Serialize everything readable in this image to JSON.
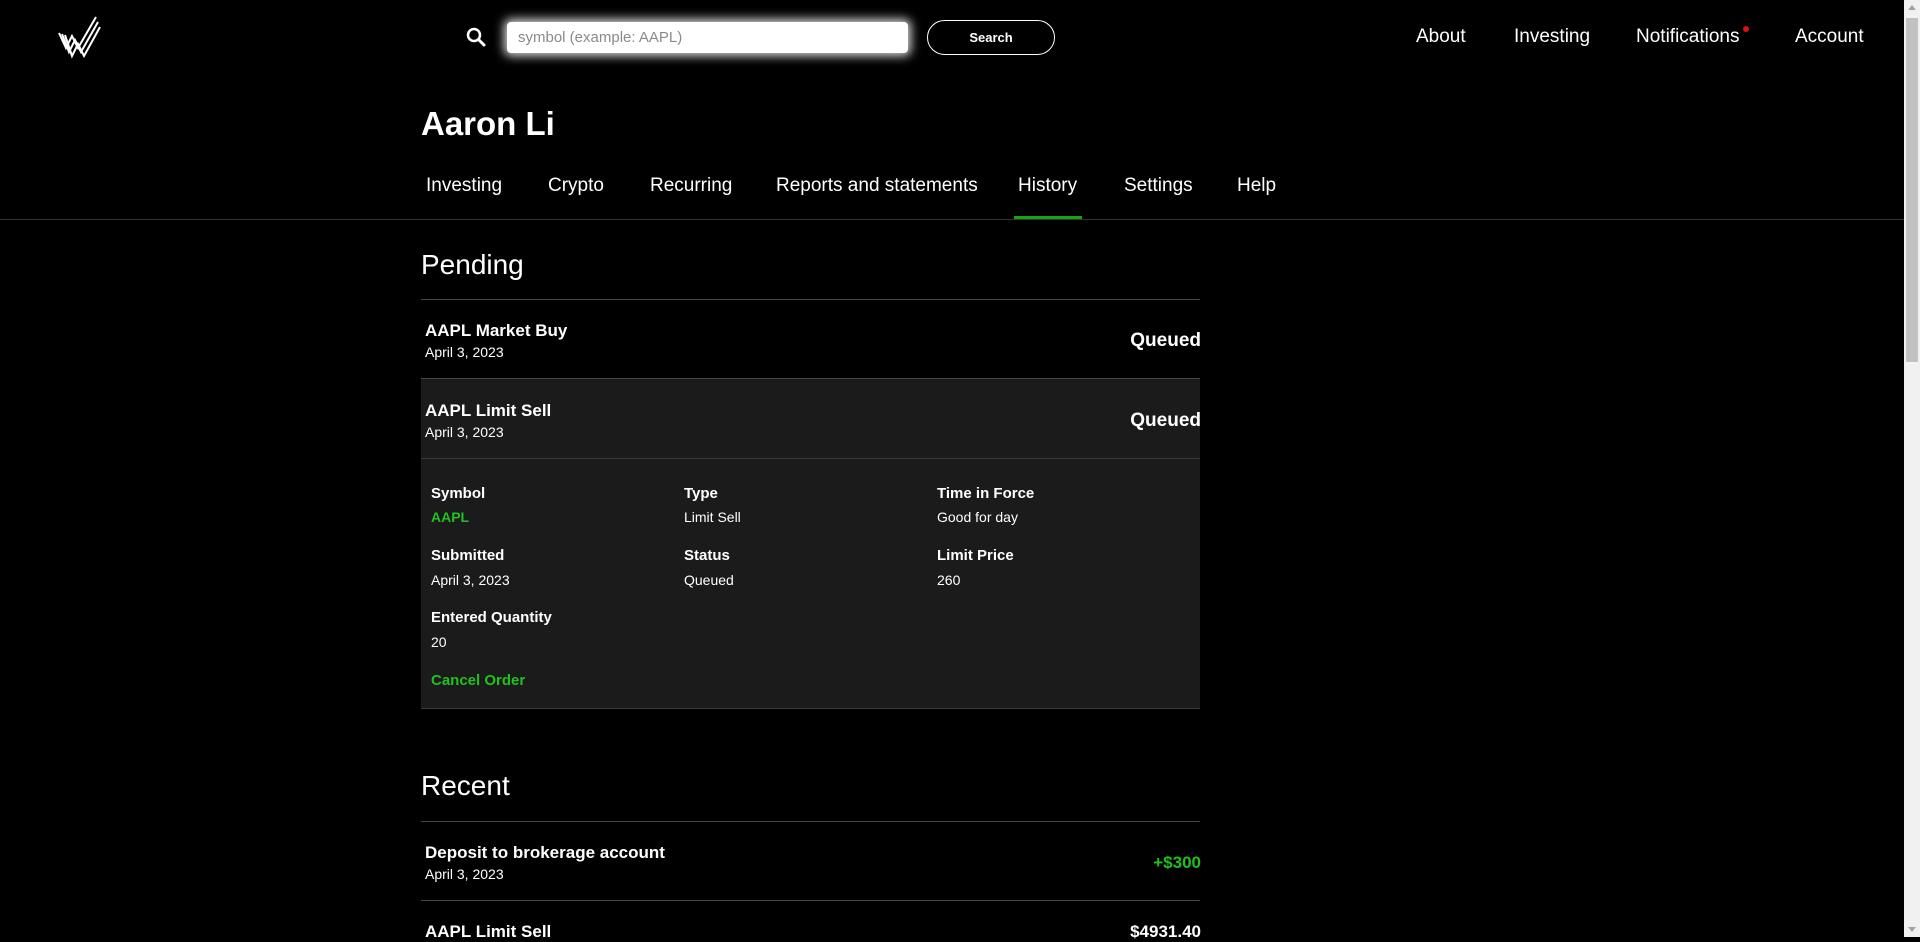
{
  "header": {
    "logo_icon": "w-logo-icon",
    "search": {
      "placeholder": "symbol (example: AAPL)",
      "value": "",
      "button_label": "Search",
      "icon": "search-icon"
    },
    "nav": [
      {
        "label": "About"
      },
      {
        "label": "Investing"
      },
      {
        "label": "Notifications",
        "has_unread": true
      },
      {
        "label": "Account"
      }
    ]
  },
  "profile": {
    "name": "Aaron Li"
  },
  "subnav": {
    "tabs": [
      {
        "label": "Investing"
      },
      {
        "label": "Crypto"
      },
      {
        "label": "Recurring"
      },
      {
        "label": "Reports and statements"
      },
      {
        "label": "History",
        "active": true
      },
      {
        "label": "Settings"
      },
      {
        "label": "Help"
      }
    ]
  },
  "pending": {
    "title": "Pending",
    "items": [
      {
        "title": "AAPL Market Buy",
        "date": "April 3, 2023",
        "status": "Queued"
      },
      {
        "title": "AAPL Limit Sell",
        "date": "April 3, 2023",
        "status": "Queued"
      }
    ],
    "expanded": {
      "symbol_label": "Symbol",
      "symbol": "AAPL",
      "type_label": "Type",
      "type": "Limit Sell",
      "tif_label": "Time in Force",
      "tif": "Good for day",
      "submitted_label": "Submitted",
      "submitted": "April 3, 2023",
      "status_label": "Status",
      "status": "Queued",
      "limit_label": "Limit Price",
      "limit": "260",
      "qty_label": "Entered Quantity",
      "qty": "20",
      "cancel_label": "Cancel Order"
    }
  },
  "recent": {
    "title": "Recent",
    "items": [
      {
        "title": "Deposit to brokerage account",
        "date": "April 3, 2023",
        "amount": "+$300"
      },
      {
        "title": "AAPL Limit Sell",
        "date": "",
        "amount": "$4931.40"
      }
    ]
  },
  "colors": {
    "accent": "#1fc11f",
    "background": "#000000",
    "panel": "#1b1b1b",
    "notification_dot": "#e01010"
  }
}
